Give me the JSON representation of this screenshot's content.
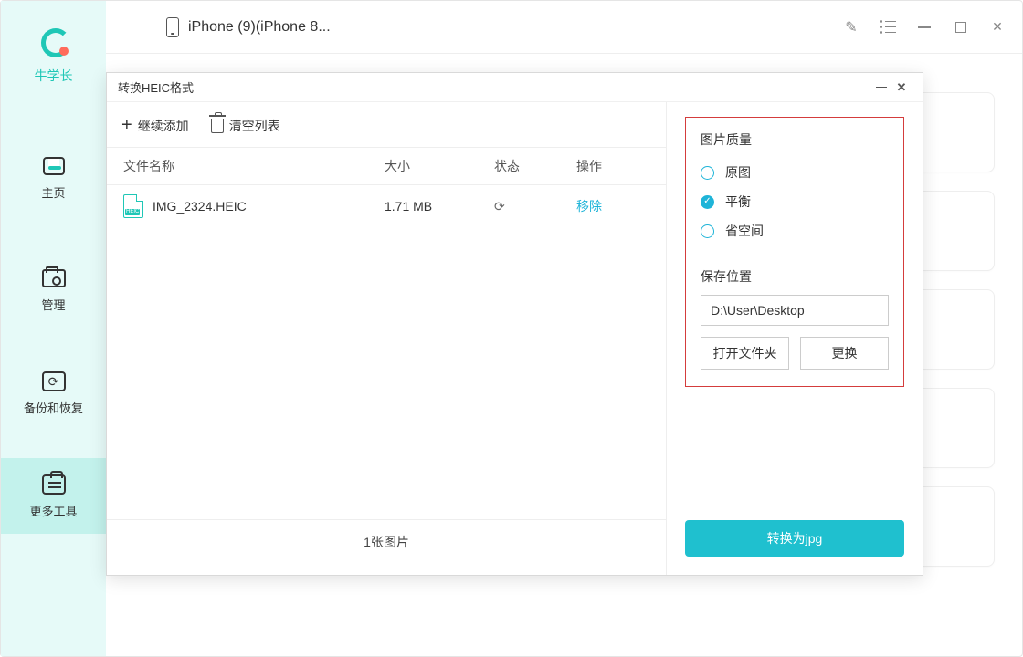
{
  "brand": {
    "name": "牛学长"
  },
  "sidebar": {
    "items": [
      {
        "label": "主页"
      },
      {
        "label": "管理"
      },
      {
        "label": "备份和恢复"
      },
      {
        "label": "更多工具"
      }
    ]
  },
  "topbar": {
    "device_name": "iPhone (9)(iPhone 8..."
  },
  "dialog": {
    "title": "转换HEIC格式",
    "toolbar": {
      "add_label": "继续添加",
      "clear_label": "清空列表"
    },
    "table": {
      "headers": {
        "name": "文件名称",
        "size": "大小",
        "status": "状态",
        "action": "操作"
      },
      "rows": [
        {
          "name": "IMG_2324.HEIC",
          "size": "1.71 MB",
          "action": "移除"
        }
      ],
      "footer": "1张图片"
    },
    "options": {
      "quality_title": "图片质量",
      "quality": [
        {
          "label": "原图",
          "checked": false
        },
        {
          "label": "平衡",
          "checked": true
        },
        {
          "label": "省空间",
          "checked": false
        }
      ],
      "save_title": "保存位置",
      "save_path": "D:\\User\\Desktop",
      "open_folder": "打开文件夹",
      "change": "更换"
    },
    "convert_label": "转换为jpg"
  }
}
